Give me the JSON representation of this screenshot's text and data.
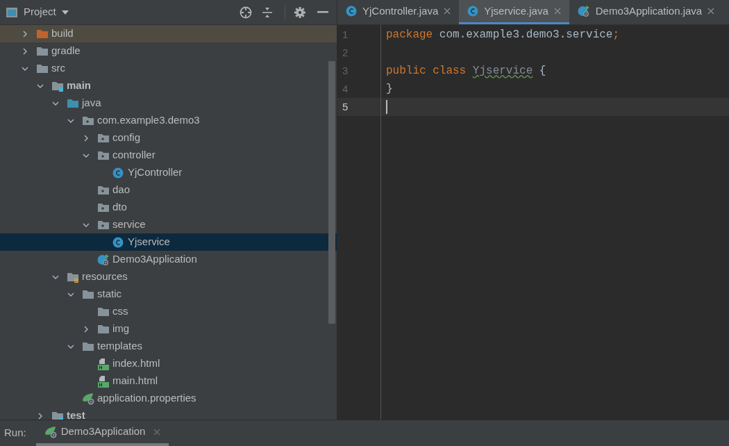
{
  "project_panel": {
    "title": "Project",
    "tree": [
      {
        "label": "build",
        "kind": "excluded",
        "expanded": false,
        "selected": false
      },
      {
        "label": "gradle",
        "kind": "folder",
        "expanded": false,
        "selected": false
      },
      {
        "label": "src",
        "kind": "folder",
        "expanded": true,
        "selected": false,
        "children": [
          {
            "label": "main",
            "kind": "source-root",
            "expanded": true,
            "selected": false,
            "children": [
              {
                "label": "java",
                "kind": "java-root",
                "expanded": true,
                "selected": false,
                "children": [
                  {
                    "label": "com.example3.demo3",
                    "kind": "package",
                    "expanded": true,
                    "selected": false,
                    "children": [
                      {
                        "label": "config",
                        "kind": "package",
                        "expanded": false,
                        "selected": false
                      },
                      {
                        "label": "controller",
                        "kind": "package",
                        "expanded": true,
                        "selected": false,
                        "children": [
                          {
                            "label": "YjController",
                            "kind": "class",
                            "selected": false
                          }
                        ]
                      },
                      {
                        "label": "dao",
                        "kind": "package",
                        "selected": false
                      },
                      {
                        "label": "dto",
                        "kind": "package",
                        "selected": false
                      },
                      {
                        "label": "service",
                        "kind": "package",
                        "expanded": true,
                        "selected": false,
                        "children": [
                          {
                            "label": "Yjservice",
                            "kind": "class",
                            "selected": true
                          }
                        ]
                      },
                      {
                        "label": "Demo3Application",
                        "kind": "spring",
                        "selected": false
                      }
                    ]
                  }
                ]
              },
              {
                "label": "resources",
                "kind": "resources-root",
                "expanded": true,
                "selected": false,
                "children": [
                  {
                    "label": "static",
                    "kind": "folder",
                    "expanded": true,
                    "selected": false,
                    "children": [
                      {
                        "label": "css",
                        "kind": "folder",
                        "selected": false
                      },
                      {
                        "label": "img",
                        "kind": "folder",
                        "expanded": false,
                        "selected": false
                      }
                    ]
                  },
                  {
                    "label": "templates",
                    "kind": "folder",
                    "expanded": true,
                    "selected": false,
                    "children": [
                      {
                        "label": "index.html",
                        "kind": "html",
                        "selected": false
                      },
                      {
                        "label": "main.html",
                        "kind": "html",
                        "selected": false
                      }
                    ]
                  },
                  {
                    "label": "application.properties",
                    "kind": "properties",
                    "selected": false
                  }
                ]
              }
            ]
          },
          {
            "label": "test",
            "kind": "source-root",
            "expanded": false,
            "selected": false
          }
        ]
      }
    ]
  },
  "tabs": [
    {
      "label": "YjController.java",
      "kind": "class",
      "selected": false
    },
    {
      "label": "Yjservice.java",
      "kind": "class",
      "selected": true
    },
    {
      "label": "Demo3Application.java",
      "kind": "spring",
      "selected": false
    }
  ],
  "editor": {
    "lines": [
      {
        "number": "1",
        "current": false,
        "tokens": [
          {
            "text": "package",
            "kind": "keyword"
          },
          {
            "text": " com.example3.demo3.service",
            "kind": "plain"
          },
          {
            "text": ";",
            "kind": "keyword"
          }
        ]
      },
      {
        "number": "2",
        "current": false
      },
      {
        "number": "3",
        "current": false,
        "tokens": [
          {
            "text": "public class ",
            "kind": "keyword"
          },
          {
            "text": "Yjservice",
            "kind": "unused"
          },
          {
            "text": " {",
            "kind": "plain"
          }
        ]
      },
      {
        "number": "4",
        "current": false,
        "tokens": [
          {
            "text": "}",
            "kind": "plain"
          }
        ]
      },
      {
        "number": "5",
        "current": true
      }
    ]
  },
  "run_bar": {
    "label": "Run:",
    "tab": "Demo3Application"
  }
}
